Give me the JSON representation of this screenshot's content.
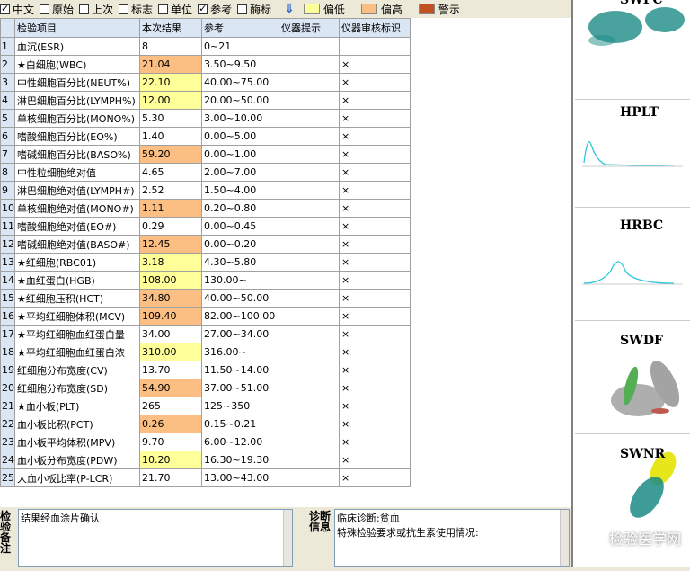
{
  "toolbar": {
    "options": [
      {
        "label": "中文",
        "checked": true
      },
      {
        "label": "原始",
        "checked": false
      },
      {
        "label": "上次",
        "checked": false
      },
      {
        "label": "标志",
        "checked": false
      },
      {
        "label": "单位",
        "checked": false
      },
      {
        "label": "参考",
        "checked": true
      },
      {
        "label": "酶标",
        "checked": false
      }
    ],
    "legend": [
      {
        "label": "偏低",
        "color": "#ffff99"
      },
      {
        "label": "偏高",
        "color": "#fbbf84"
      },
      {
        "label": "警示",
        "color": "#c0501f"
      }
    ]
  },
  "table": {
    "headers": [
      "检验项目",
      "本次结果",
      "参考",
      "仪器提示",
      "仪器审核标识"
    ],
    "rows": [
      {
        "n": "1",
        "name": "血沉(ESR)",
        "result": "8",
        "flag": "",
        "ref": "0~21",
        "note": ""
      },
      {
        "n": "2",
        "name": "★白细胞(WBC)",
        "result": "21.04",
        "flag": "high",
        "ref": "3.50~9.50",
        "note": "×"
      },
      {
        "n": "3",
        "name": "中性细胞百分比(NEUT%)",
        "result": "22.10",
        "flag": "low",
        "ref": "40.00~75.00",
        "note": "×"
      },
      {
        "n": "4",
        "name": "淋巴细胞百分比(LYMPH%)",
        "result": "12.00",
        "flag": "low",
        "ref": "20.00~50.00",
        "note": "×"
      },
      {
        "n": "5",
        "name": "单核细胞百分比(MONO%)",
        "result": "5.30",
        "flag": "",
        "ref": "3.00~10.00",
        "note": "×"
      },
      {
        "n": "6",
        "name": "嗜酸细胞百分比(EO%)",
        "result": "1.40",
        "flag": "",
        "ref": "0.00~5.00",
        "note": "×"
      },
      {
        "n": "7",
        "name": "嗜碱细胞百分比(BASO%)",
        "result": "59.20",
        "flag": "high",
        "ref": "0.00~1.00",
        "note": "×"
      },
      {
        "n": "8",
        "name": "中性粒细胞绝对值",
        "result": "4.65",
        "flag": "",
        "ref": "2.00~7.00",
        "note": "×"
      },
      {
        "n": "9",
        "name": "淋巴细胞绝对值(LYMPH#)",
        "result": "2.52",
        "flag": "",
        "ref": "1.50~4.00",
        "note": "×"
      },
      {
        "n": "10",
        "name": "单核细胞绝对值(MONO#)",
        "result": "1.11",
        "flag": "high",
        "ref": "0.20~0.80",
        "note": "×"
      },
      {
        "n": "11",
        "name": "嗜酸细胞绝对值(EO#)",
        "result": "0.29",
        "flag": "",
        "ref": "0.00~0.45",
        "note": "×"
      },
      {
        "n": "12",
        "name": "嗜碱细胞绝对值(BASO#)",
        "result": "12.45",
        "flag": "high",
        "ref": "0.00~0.20",
        "note": "×"
      },
      {
        "n": "13",
        "name": "★红细胞(RBC01)",
        "result": "3.18",
        "flag": "low",
        "ref": "4.30~5.80",
        "note": "×"
      },
      {
        "n": "14",
        "name": "★血红蛋白(HGB)",
        "result": "108.00",
        "flag": "low",
        "ref": "130.00~",
        "note": "×"
      },
      {
        "n": "15",
        "name": "★红细胞压积(HCT)",
        "result": "34.80",
        "flag": "high",
        "ref": "40.00~50.00",
        "note": "×"
      },
      {
        "n": "16",
        "name": "★平均红细胞体积(MCV)",
        "result": "109.40",
        "flag": "high",
        "ref": "82.00~100.00",
        "note": "×"
      },
      {
        "n": "17",
        "name": "★平均红细胞血红蛋白量",
        "result": "34.00",
        "flag": "",
        "ref": "27.00~34.00",
        "note": "×"
      },
      {
        "n": "18",
        "name": "★平均红细胞血红蛋白浓",
        "result": "310.00",
        "flag": "low",
        "ref": "316.00~",
        "note": "×"
      },
      {
        "n": "19",
        "name": "红细胞分布宽度(CV)",
        "result": "13.70",
        "flag": "",
        "ref": "11.50~14.00",
        "note": "×"
      },
      {
        "n": "20",
        "name": "红细胞分布宽度(SD)",
        "result": "54.90",
        "flag": "high",
        "ref": "37.00~51.00",
        "note": "×"
      },
      {
        "n": "21",
        "name": "★血小板(PLT)",
        "result": "265",
        "flag": "",
        "ref": "125~350",
        "note": "×"
      },
      {
        "n": "22",
        "name": "血小板比积(PCT)",
        "result": "0.26",
        "flag": "high",
        "ref": "0.15~0.21",
        "note": "×"
      },
      {
        "n": "23",
        "name": "血小板平均体积(MPV)",
        "result": "9.70",
        "flag": "",
        "ref": "6.00~12.00",
        "note": "×"
      },
      {
        "n": "24",
        "name": "血小板分布宽度(PDW)",
        "result": "10.20",
        "flag": "low",
        "ref": "16.30~19.30",
        "note": "×"
      },
      {
        "n": "25",
        "name": "大血小板比率(P-LCR)",
        "result": "21.70",
        "flag": "",
        "ref": "13.00~43.00",
        "note": "×"
      }
    ]
  },
  "bottom": {
    "remark_label": "检验备注",
    "remark_text": "结果经血涂片确认",
    "diag_label": "诊断信息",
    "diag_text": "临床诊断:贫血",
    "diag_text2": "特殊检验要求或抗生素使用情况:"
  },
  "scattergrams": [
    "SWPC",
    "HPLT",
    "HRBC",
    "SWDF",
    "SWNR"
  ],
  "watermark": "检验医学网"
}
